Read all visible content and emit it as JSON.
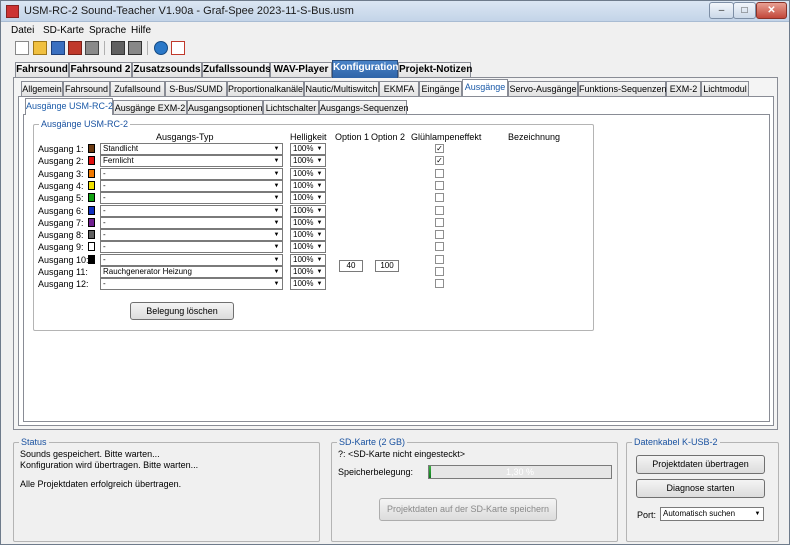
{
  "window": {
    "title": "USM-RC-2 Sound-Teacher V1.90a - Graf-Spee 2023-11-S-Bus.usm",
    "min_glyph": "–",
    "max_glyph": "□",
    "close_glyph": "✕"
  },
  "menu": {
    "file": "Datei",
    "sd": "SD-Karte",
    "language": "Sprache",
    "help": "Hilfe"
  },
  "tabs_main": [
    "Fahrsound",
    "Fahrsound 2",
    "Zusatzsounds",
    "Zufallssounds",
    "WAV-Player",
    "Konfiguration",
    "Projekt-Notizen"
  ],
  "tabs_config": [
    "Allgemein",
    "Fahrsound",
    "Zufallsound",
    "S-Bus/SUMD",
    "Proportionalkanäle",
    "Nautic/Multiswitch",
    "EKMFA",
    "Eingänge",
    "Ausgänge",
    "Servo-Ausgänge",
    "Funktions-Sequenzen",
    "EXM-2",
    "Lichtmodul"
  ],
  "tabs_outputs": [
    "Ausgänge USM-RC-2",
    "Ausgänge EXM-2",
    "Ausgangsoptionen",
    "Lichtschalter",
    "Ausgangs-Sequenzen"
  ],
  "outputs_group": {
    "title": "Ausgänge USM-RC-2",
    "headers": {
      "type": "Ausgangs-Typ",
      "brightness": "Helligkeit",
      "option1": "Option 1",
      "option2": "Option 2",
      "bulb": "Glühlampeneffekt",
      "name": "Bezeichnung"
    },
    "rows": [
      {
        "label": "Ausgang 1:",
        "color": "#6b3a12",
        "type": "Standlicht",
        "brightness": "100%",
        "option1": "",
        "option2": "",
        "bulb": true
      },
      {
        "label": "Ausgang 2:",
        "color": "#e01010",
        "type": "Fernlicht",
        "brightness": "100%",
        "option1": "",
        "option2": "",
        "bulb": true
      },
      {
        "label": "Ausgang 3:",
        "color": "#f07800",
        "type": "-",
        "brightness": "100%",
        "option1": "",
        "option2": "",
        "bulb": false
      },
      {
        "label": "Ausgang 4:",
        "color": "#f0e000",
        "type": "-",
        "brightness": "100%",
        "option1": "",
        "option2": "",
        "bulb": false
      },
      {
        "label": "Ausgang 5:",
        "color": "#10a010",
        "type": "-",
        "brightness": "100%",
        "option1": "",
        "option2": "",
        "bulb": false
      },
      {
        "label": "Ausgang 6:",
        "color": "#1030c0",
        "type": "-",
        "brightness": "100%",
        "option1": "",
        "option2": "",
        "bulb": false
      },
      {
        "label": "Ausgang 7:",
        "color": "#702090",
        "type": "-",
        "brightness": "100%",
        "option1": "",
        "option2": "",
        "bulb": false
      },
      {
        "label": "Ausgang 8:",
        "color": "#606060",
        "type": "-",
        "brightness": "100%",
        "option1": "",
        "option2": "",
        "bulb": false
      },
      {
        "label": "Ausgang 9:",
        "color": "#ffffff",
        "type": "-",
        "brightness": "100%",
        "option1": "",
        "option2": "",
        "bulb": false
      },
      {
        "label": "Ausgang 10:",
        "color": "#000000",
        "type": "-",
        "brightness": "100%",
        "option1": "",
        "option2": "",
        "bulb": false
      },
      {
        "label": "Ausgang 11:",
        "color": "",
        "type": "Rauchgenerator Heizung",
        "brightness": "100%",
        "option1": "40",
        "option2": "100",
        "bulb": false
      },
      {
        "label": "Ausgang 12:",
        "color": "",
        "type": "-",
        "brightness": "100%",
        "option1": "",
        "option2": "",
        "bulb": false
      }
    ],
    "clear_button": "Belegung löschen"
  },
  "status": {
    "title": "Status",
    "lines": [
      "Sounds gespeichert. Bitte warten...",
      "Konfiguration wird übertragen. Bitte warten...",
      "",
      "Alle Projektdaten erfolgreich übertragen."
    ]
  },
  "sdcard": {
    "title": "SD-Karte (2 GB)",
    "info": "?: <SD-Karte nicht eingesteckt>",
    "usage_label": "Speicherbelegung:",
    "usage_percent": 1.3,
    "usage_text": "1,30 %",
    "save_button": "Projektdaten auf der SD-Karte speichern"
  },
  "cable": {
    "title": "Datenkabel K-USB-2",
    "transfer_button": "Projektdaten übertragen",
    "diagnose_button": "Diagnose starten",
    "port_label": "Port:",
    "port_value": "Automatisch suchen"
  }
}
